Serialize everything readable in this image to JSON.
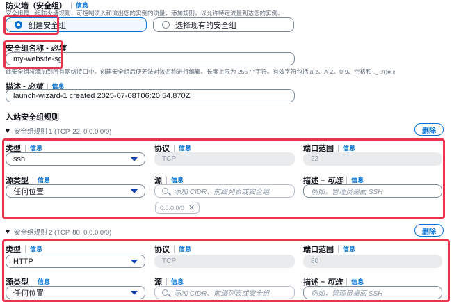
{
  "firewall": {
    "title": "防火墙（安全组）",
    "info": "信息",
    "description": "安全组是一组防火墙规则，可控制流入和流出您的实例的流量。添加规则，以允许特定流量到达您的实例。",
    "options": [
      {
        "label": "创建安全组",
        "selected": true
      },
      {
        "label": "选择现有的安全组",
        "selected": false
      }
    ]
  },
  "sg_name": {
    "label": "安全组名称",
    "required": "必填",
    "value": "my-website-sg",
    "hint": "此安全组将添加到所有网络接口中。创建安全组后便无法对该名称进行编辑。长度上限为 255 个字符。有效字符包括 a-z、A-Z、0-9、空格和 ._-:/()#,@[]+=&;{}!$*"
  },
  "sg_desc": {
    "label": "描述",
    "required": "必填",
    "info": "信息",
    "value": "launch-wizard-1 created 2025-07-08T06:20:54.870Z"
  },
  "inbound": {
    "title": "入站安全组规则",
    "labels": {
      "type": "类型",
      "protocol": "协议",
      "port_range": "端口范围",
      "source_type": "源类型",
      "source": "源",
      "description": "描述",
      "optional": "可选",
      "info": "信息",
      "remove": "删除"
    },
    "placeholders": {
      "source": "添加 CIDR、前缀列表或安全组",
      "description": "例如，管理员桌面 SSH"
    },
    "rules": [
      {
        "heading": "安全组规则 1 (TCP, 22, 0.0.0.0/0)",
        "type": "ssh",
        "protocol": "TCP",
        "port": "22",
        "source_type": "任何位置",
        "source_token": "0.0.0.0/0"
      },
      {
        "heading": "安全组规则 2 (TCP, 80, 0.0.0.0/0)",
        "type": "HTTP",
        "protocol": "TCP",
        "port": "80",
        "source_type": "任何位置"
      }
    ]
  },
  "colors": {
    "accent": "#0972d3",
    "highlight": "#e8344c",
    "selected_bg": "#f2f8fd"
  }
}
